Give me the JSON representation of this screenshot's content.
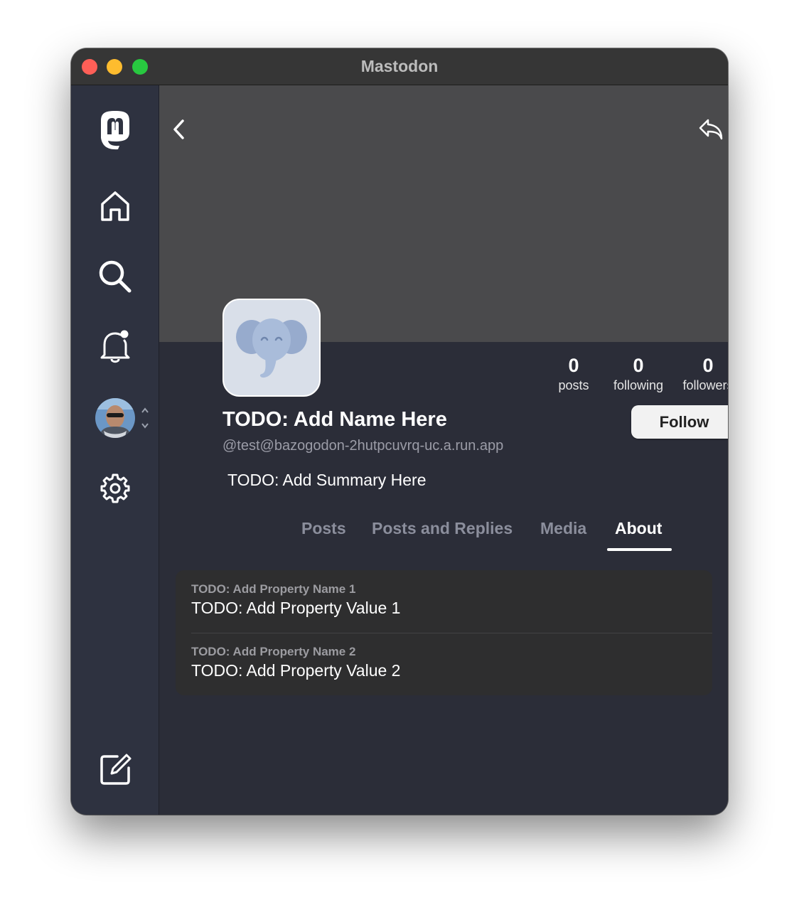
{
  "window": {
    "title": "Mastodon"
  },
  "sidebar": {
    "items": [
      {
        "name": "logo"
      },
      {
        "name": "home"
      },
      {
        "name": "search"
      },
      {
        "name": "notifications"
      },
      {
        "name": "account"
      },
      {
        "name": "settings"
      },
      {
        "name": "compose"
      }
    ]
  },
  "profile": {
    "name": "TODO: Add Name Here",
    "handle": "@test@bazogodon-2hutpcuvrq-uc.a.run.app",
    "summary": "TODO: Add Summary Here",
    "follow_label": "Follow",
    "stats": [
      {
        "value": "0",
        "label": "posts"
      },
      {
        "value": "0",
        "label": "following"
      },
      {
        "value": "0",
        "label": "followers"
      }
    ]
  },
  "tabs": [
    {
      "label": "Posts",
      "active": false
    },
    {
      "label": "Posts and Replies",
      "active": false
    },
    {
      "label": "Media",
      "active": false
    },
    {
      "label": "About",
      "active": true
    }
  ],
  "properties": [
    {
      "name": "TODO: Add Property Name 1",
      "value": "TODO: Add Property Value 1"
    },
    {
      "name": "TODO: Add Property Name 2",
      "value": "TODO: Add Property Value 2"
    }
  ],
  "colors": {
    "sidebar_bg": "#2e3240",
    "main_bg": "#2b2d38",
    "header_bg": "#4a4a4c",
    "mastodon_logo": "#ffffff"
  }
}
